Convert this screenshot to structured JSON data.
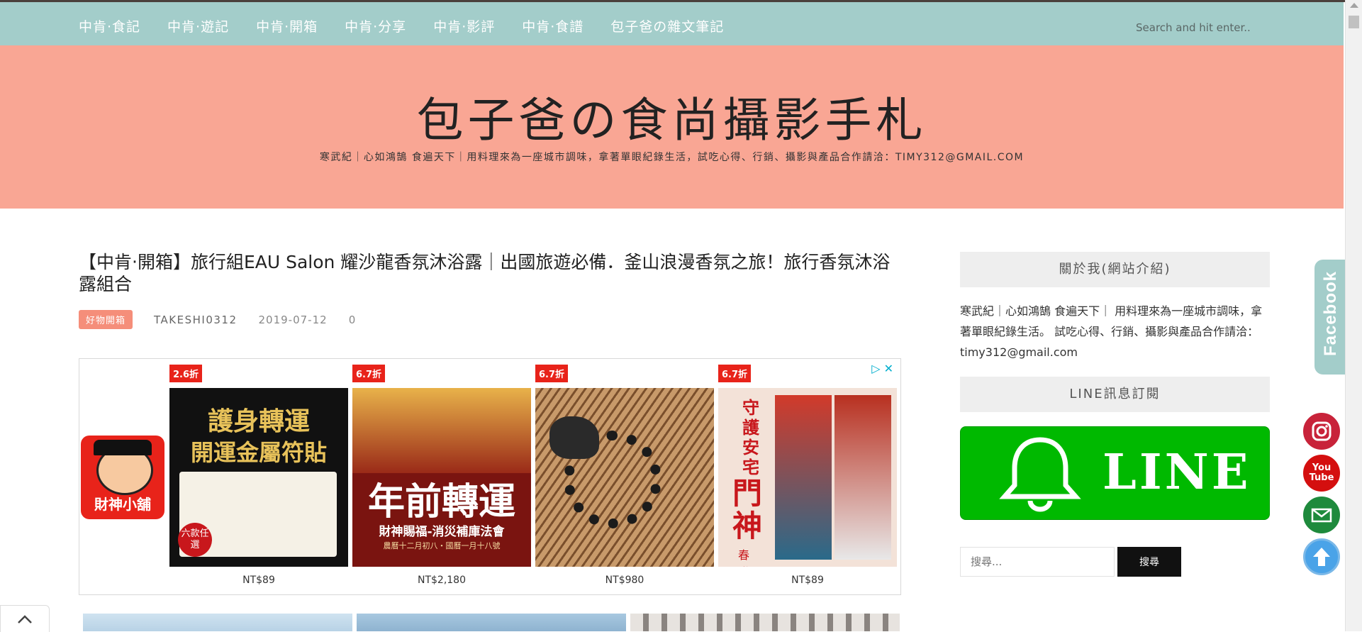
{
  "nav": {
    "items": [
      {
        "label": "中肯‧食記"
      },
      {
        "label": "中肯‧遊記"
      },
      {
        "label": "中肯‧開箱"
      },
      {
        "label": "中肯‧分享"
      },
      {
        "label": "中肯‧影評"
      },
      {
        "label": "中肯‧食譜"
      },
      {
        "label": "包子爸の雜文筆記"
      }
    ],
    "search_placeholder": "Search and hit enter.."
  },
  "header": {
    "title": "包子爸の食尚攝影手札",
    "tagline": "寒武紀｜心如鴻鵠 食遍天下｜用料理來為一座城市調味，拿著單眼紀錄生活，試吃心得、行銷、攝影與產品合作請洽：TIMY312@GMAIL.COM"
  },
  "post": {
    "title": "【中肯‧開箱】旅行組EAU Salon 耀沙龍香氛沐浴露｜出國旅遊必備．釜山浪漫香氛之旅！旅行香氛沐浴露組合",
    "category": "好物開箱",
    "author": "TAKESHI0312",
    "date": "2019-07-12",
    "comments": "0"
  },
  "ad": {
    "logo_text": "財神小舖",
    "products": [
      {
        "discount": "2.6折",
        "price": "NT$89",
        "line1": "護身轉運",
        "line2": "開運金屬符貼",
        "corner": "六款任選",
        "bg": "#111111",
        "fg": "#e8c25a"
      },
      {
        "discount": "6.7折",
        "price": "NT$2,180",
        "line1": "年前轉運",
        "line2": "財神賜福-消災補庫法會",
        "line3": "農曆十二月初八・國曆一月十八號",
        "bg": "#7a1410",
        "fg": "#ffffff"
      },
      {
        "discount": "6.7折",
        "price": "NT$980",
        "bg": "#a86b43",
        "fg": "#222222"
      },
      {
        "discount": "6.7折",
        "price": "NT$89",
        "vertical": "守護安宅",
        "big": "門神",
        "small": "春聯",
        "bg": "#f3e2d8",
        "fg": "#c8171c"
      }
    ]
  },
  "sidebar": {
    "about_title": "關於我(網站介紹)",
    "about_text": "寒武紀｜心如鴻鵠 食遍天下｜ 用料理來為一座城市調味，拿著單眼紀錄生活。 試吃心得、行銷、攝影與產品合作請洽：timy312@gmail.com",
    "line_title": "LINE訊息訂閱",
    "line_banner_text": "LINE",
    "search_placeholder": "搜尋...",
    "search_button": "搜尋"
  },
  "facebook_tab": "Facebook",
  "social_icons": [
    {
      "name": "instagram-icon",
      "color": "#c8233a",
      "label": ""
    },
    {
      "name": "youtube-icon",
      "color": "#d40f0f",
      "label": "You Tube"
    },
    {
      "name": "email-icon",
      "color": "#1e8a3c",
      "label": "@"
    },
    {
      "name": "back-to-top-icon",
      "color": "#4aa3e8",
      "label": ""
    }
  ],
  "colors": {
    "nav": "#a3cdca",
    "header": "#f9a694",
    "badge": "#f58e7a",
    "line": "#00b900"
  }
}
